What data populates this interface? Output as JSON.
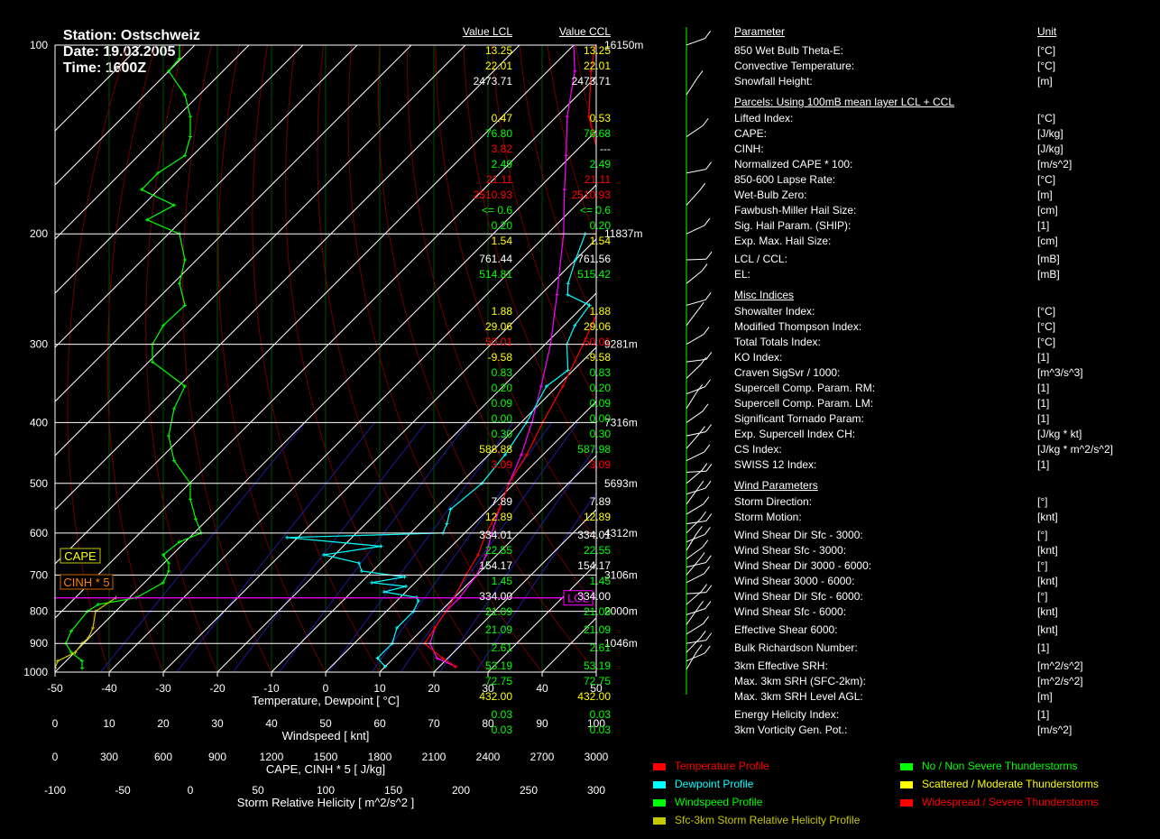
{
  "header": {
    "station": "Station: Ostschweiz",
    "date": "Date: 19.03.2005",
    "time": "Time: 1600Z"
  },
  "colors": {
    "temperature": "#ff0000",
    "dewpoint": "#00ffff",
    "windspeed": "#00ff00",
    "srh": "#c8c800",
    "parcel": "#ff00ff",
    "isotherm": "#005000",
    "isohume": "#1c1c9a",
    "dry_adiabat": "#6a0000"
  },
  "chart_data": {
    "type": "line",
    "title": "",
    "xlabel": "Temperature, Dewpoint [ °C]",
    "ylabel": "",
    "x_axes": [
      {
        "label": "Temperature, Dewpoint [ °C]",
        "ticks": [
          "-50",
          "-40",
          "-30",
          "-20",
          "-10",
          "0",
          "10",
          "20",
          "30",
          "40",
          "50"
        ],
        "range": [
          -50,
          50
        ]
      },
      {
        "label": "Windspeed [ knt]",
        "ticks": [
          "0",
          "10",
          "20",
          "30",
          "40",
          "50",
          "60",
          "70",
          "80",
          "90",
          "100"
        ],
        "range": [
          0,
          100
        ]
      },
      {
        "label": "CAPE, CINH * 5 [ J/kg]",
        "ticks": [
          "0",
          "300",
          "600",
          "900",
          "1200",
          "1500",
          "1800",
          "2100",
          "2400",
          "2700",
          "3000"
        ],
        "range": [
          0,
          3000
        ]
      },
      {
        "label": "Storm Relative Helicity [ m^2/s^2 ]",
        "ticks": [
          "-100",
          "-50",
          "0",
          "50",
          "100",
          "150",
          "200",
          "250",
          "300"
        ],
        "range": [
          -100,
          300
        ]
      }
    ],
    "pressure_levels": [
      {
        "p": 100,
        "label": "100",
        "height": "16150m"
      },
      {
        "p": 200,
        "label": "200",
        "height": "11837m"
      },
      {
        "p": 300,
        "label": "300",
        "height": "9281m"
      },
      {
        "p": 400,
        "label": "400",
        "height": "7316m"
      },
      {
        "p": 500,
        "label": "500",
        "height": "5693m"
      },
      {
        "p": 600,
        "label": "600",
        "height": "4312m"
      },
      {
        "p": 700,
        "label": "700",
        "height": "3106m"
      },
      {
        "p": 800,
        "label": "800",
        "height": "2000m"
      },
      {
        "p": 900,
        "label": "900",
        "height": "1046m"
      },
      {
        "p": 1000,
        "label": "1000",
        "height": ""
      }
    ],
    "annotations": {
      "cape": "CAPE",
      "cinh": "CINH * 5",
      "lcl": "LCL",
      "lcl_p": 761.44
    },
    "series": [
      {
        "name": "Temperature Profile",
        "unit": "°C",
        "points": [
          [
            980,
            23
          ],
          [
            950,
            19
          ],
          [
            900,
            13
          ],
          [
            850,
            12
          ],
          [
            800,
            11
          ],
          [
            761,
            10
          ],
          [
            700,
            8
          ],
          [
            650,
            6.5
          ],
          [
            600,
            4
          ],
          [
            550,
            2
          ],
          [
            500,
            -1
          ],
          [
            450,
            -3
          ],
          [
            400,
            -6
          ],
          [
            350,
            -9
          ],
          [
            300,
            -13
          ],
          [
            250,
            -18
          ],
          [
            220,
            -22
          ],
          [
            200,
            -26
          ],
          [
            190,
            -30
          ],
          [
            170,
            -37
          ],
          [
            150,
            -45
          ],
          [
            130,
            -54
          ],
          [
            110,
            -62
          ],
          [
            100,
            -66
          ]
        ]
      },
      {
        "name": "Dewpoint Profile",
        "unit": "°C",
        "points": [
          [
            980,
            10
          ],
          [
            950,
            7
          ],
          [
            900,
            7
          ],
          [
            850,
            5
          ],
          [
            800,
            5
          ],
          [
            770,
            4
          ],
          [
            760,
            3
          ],
          [
            745,
            -4
          ],
          [
            730,
            -1
          ],
          [
            720,
            -8
          ],
          [
            705,
            -3
          ],
          [
            690,
            -12
          ],
          [
            670,
            -14
          ],
          [
            650,
            -22
          ],
          [
            630,
            -13
          ],
          [
            610,
            -32
          ],
          [
            600,
            -4
          ],
          [
            580,
            -5
          ],
          [
            550,
            -7
          ],
          [
            500,
            -6
          ],
          [
            450,
            -7
          ],
          [
            400,
            -9
          ],
          [
            350,
            -12
          ],
          [
            330,
            -11
          ],
          [
            300,
            -16
          ],
          [
            280,
            -18
          ],
          [
            260,
            -19
          ],
          [
            250,
            -25
          ],
          [
            240,
            -27
          ],
          [
            220,
            -30
          ],
          [
            200,
            -33
          ]
        ]
      },
      {
        "name": "Parcel",
        "unit": "°C",
        "points": [
          [
            980,
            23
          ],
          [
            950,
            18
          ],
          [
            900,
            14
          ],
          [
            850,
            12
          ],
          [
            800,
            11
          ],
          [
            761,
            11
          ],
          [
            700,
            10
          ],
          [
            650,
            8
          ],
          [
            600,
            5
          ],
          [
            550,
            2
          ],
          [
            500,
            -1
          ],
          [
            450,
            -4
          ],
          [
            400,
            -8
          ],
          [
            350,
            -13
          ],
          [
            300,
            -19
          ],
          [
            250,
            -27
          ],
          [
            200,
            -37
          ],
          [
            170,
            -45
          ],
          [
            150,
            -51
          ],
          [
            130,
            -58
          ],
          [
            110,
            -65
          ],
          [
            100,
            -70
          ]
        ]
      },
      {
        "name": "Windspeed Profile",
        "unit": "knt",
        "points": [
          [
            985,
            5
          ],
          [
            960,
            5
          ],
          [
            930,
            3
          ],
          [
            900,
            2
          ],
          [
            860,
            3
          ],
          [
            800,
            6
          ],
          [
            780,
            8
          ],
          [
            761,
            15
          ],
          [
            720,
            20
          ],
          [
            690,
            21
          ],
          [
            670,
            21
          ],
          [
            650,
            20
          ],
          [
            620,
            23
          ],
          [
            600,
            27
          ],
          [
            570,
            26
          ],
          [
            530,
            25
          ],
          [
            500,
            25
          ],
          [
            460,
            22
          ],
          [
            420,
            21
          ],
          [
            380,
            22
          ],
          [
            350,
            24
          ],
          [
            320,
            18
          ],
          [
            300,
            18
          ],
          [
            280,
            20
          ],
          [
            260,
            24
          ],
          [
            240,
            23
          ],
          [
            220,
            24
          ],
          [
            200,
            23
          ],
          [
            190,
            17
          ],
          [
            180,
            22
          ],
          [
            170,
            16
          ],
          [
            160,
            19
          ],
          [
            150,
            24
          ],
          [
            140,
            25
          ],
          [
            130,
            25
          ],
          [
            120,
            24
          ],
          [
            110,
            21
          ],
          [
            105,
            23
          ],
          [
            100,
            23
          ]
        ]
      },
      {
        "name": "Sfc-3km Storm Relative Helicity Profile",
        "unit": "m^2/s^2",
        "points": [
          [
            985,
            -100
          ],
          [
            960,
            -98
          ],
          [
            930,
            -85
          ],
          [
            900,
            -80
          ],
          [
            880,
            -75
          ],
          [
            850,
            -72
          ],
          [
            800,
            -70
          ],
          [
            761,
            -55
          ]
        ]
      }
    ],
    "wind_barbs_note": "Wind barbs shown on right-hand column"
  },
  "legend": [
    {
      "label": "Temperature Profile",
      "color": "#ff0000",
      "text_color": "#ff0000"
    },
    {
      "label": "Dewpoint Profile",
      "color": "#00ffff",
      "text_color": "#00ffff"
    },
    {
      "label": "Windspeed Profile",
      "color": "#00ff00",
      "text_color": "#00ff00"
    },
    {
      "label": "Sfc-3km Storm Relative Helicity Profile",
      "color": "#c8c800",
      "text_color": "#c8c800"
    },
    {
      "label": "No / Non Severe Thunderstorms",
      "color": "#00ff00",
      "text_color": "#00ff00"
    },
    {
      "label": "Scattered / Moderate Thunderstorms",
      "color": "#ffff00",
      "text_color": "#ffff00"
    },
    {
      "label": "Widespread / Severe Thunderstorms",
      "color": "#ff0000",
      "text_color": "#ff0000"
    }
  ],
  "table": {
    "header": {
      "param": "Parameter",
      "lcl": "Value LCL",
      "ccl": "Value CCL",
      "unit": "Unit"
    },
    "rows": [
      {
        "label": "850 Wet Bulb Theta-E:",
        "v1": "13.25",
        "v2": "13.25",
        "unit": "[°C]",
        "c": "yellow"
      },
      {
        "label": "Convective Temperature:",
        "v1": "22.01",
        "v2": "22.01",
        "unit": "[°C]",
        "c": "yellow"
      },
      {
        "label": "Snowfall Height:",
        "v1": "2473.71",
        "v2": "2473.71",
        "unit": "[m]",
        "c": "white"
      },
      {
        "section": "Parcels: Using 100mB mean layer LCL + CCL"
      },
      {
        "label": "Lifted Index:",
        "v1": "0.47",
        "v2": "0.53",
        "unit": "[°C]",
        "c": "yellow"
      },
      {
        "label": "CAPE:",
        "v1": "76.80",
        "v2": "76.68",
        "unit": "[J/kg]",
        "c": "green"
      },
      {
        "label": "CINH:",
        "v1": "3.82",
        "v2": "---",
        "unit": "[J/kg]",
        "c": "red",
        "c2": "white"
      },
      {
        "label": "Normalized CAPE * 100:",
        "v1": "2.49",
        "v2": "2.49",
        "unit": "[m/s^2]",
        "c": "green"
      },
      {
        "label": "850-600 Lapse Rate:",
        "v1": "21.11",
        "v2": "21.11",
        "unit": "[°C]",
        "c": "red"
      },
      {
        "label": "Wet-Bulb Zero:",
        "v1": "2510.93",
        "v2": "2510.93",
        "unit": "[m]",
        "c": "red"
      },
      {
        "label": "Fawbush-Miller Hail Size:",
        "v1": "<= 0.6",
        "v2": "<= 0.6",
        "unit": "[cm]",
        "c": "green"
      },
      {
        "label": "Sig. Hail Param. (SHIP):",
        "v1": "0.20",
        "v2": "0.20",
        "unit": "[1]",
        "c": "green"
      },
      {
        "label": "Exp. Max. Hail Size:",
        "v1": "1.54",
        "v2": "1.54",
        "unit": "[cm]",
        "c": "yellow"
      },
      {
        "label": "LCL / CCL:",
        "v1": "761.44",
        "v2": "761.56",
        "unit": "[mB]",
        "c": "white",
        "gap": 3
      },
      {
        "label": "EL:",
        "v1": "514.81",
        "v2": "515.42",
        "unit": "[mB]",
        "c": "green"
      },
      {
        "section": "Misc Indices"
      },
      {
        "label": "Showalter Index:",
        "v1": "1.88",
        "v2": "1.88",
        "unit": "[°C]",
        "c": "yellow"
      },
      {
        "label": "Modified Thompson Index:",
        "v1": "29.06",
        "v2": "29.06",
        "unit": "[°C]",
        "c": "yellow"
      },
      {
        "label": "Total Totals Index:",
        "v1": "50.01",
        "v2": "50.01",
        "unit": "[°C]",
        "c": "red"
      },
      {
        "label": "KO Index:",
        "v1": "-9.58",
        "v2": "-9.58",
        "unit": "[1]",
        "c": "yellow"
      },
      {
        "label": "Craven SigSvr / 1000:",
        "v1": "0.83",
        "v2": "0.83",
        "unit": "[m^3/s^3]",
        "c": "green"
      },
      {
        "label": "Supercell Comp. Param. RM:",
        "v1": "0.20",
        "v2": "0.20",
        "unit": "[1]",
        "c": "green"
      },
      {
        "label": "Supercell Comp. Param. LM:",
        "v1": "0.09",
        "v2": "0.09",
        "unit": "[1]",
        "c": "green"
      },
      {
        "label": "Significant Tornado Param:",
        "v1": "0.00",
        "v2": "0.00",
        "unit": "[1]",
        "c": "green"
      },
      {
        "label": "Exp. Supercell Index CH:",
        "v1": "0.30",
        "v2": "0.30",
        "unit": "[J/kg * kt]",
        "c": "green"
      },
      {
        "label": "CS Index:",
        "v1": "588.88",
        "v2": "587.98",
        "unit": "[J/kg * m^2/s^2]",
        "c": "yellow",
        "c2": "green"
      },
      {
        "label": "SWISS 12 Index:",
        "v1": "3.09",
        "v2": "3.09",
        "unit": "[1]",
        "c": "red"
      },
      {
        "section": "Wind Parameters"
      },
      {
        "label": "Storm Direction:",
        "v1": "7.89",
        "v2": "7.89",
        "unit": "[°]",
        "c": "white"
      },
      {
        "label": "Storm Motion:",
        "v1": "12.89",
        "v2": "12.89",
        "unit": "[knt]",
        "c": "yellow"
      },
      {
        "label": "Wind Shear Dir Sfc - 3000:",
        "v1": "334.01",
        "v2": "334.01",
        "unit": "[°]",
        "c": "white",
        "gap": 3
      },
      {
        "label": "Wind Shear Sfc - 3000:",
        "v1": "22.55",
        "v2": "22.55",
        "unit": "[knt]",
        "c": "green"
      },
      {
        "label": "Wind Shear Dir 3000 - 6000:",
        "v1": "154.17",
        "v2": "154.17",
        "unit": "[°]",
        "c": "white"
      },
      {
        "label": "Wind Shear 3000 - 6000:",
        "v1": "1.45",
        "v2": "1.45",
        "unit": "[knt]",
        "c": "green"
      },
      {
        "label": "Wind Shear Dir Sfc - 6000:",
        "v1": "334.00",
        "v2": "334.00",
        "unit": "[°]",
        "c": "white"
      },
      {
        "label": "Wind Shear Sfc - 6000:",
        "v1": "21.09",
        "v2": "21.09",
        "unit": "[knt]",
        "c": "green"
      },
      {
        "label": "Effective Shear 6000:",
        "v1": "21.09",
        "v2": "21.09",
        "unit": "[knt]",
        "c": "green",
        "gap": 3
      },
      {
        "label": "Bulk Richardson Number:",
        "v1": "2.61",
        "v2": "2.61",
        "unit": "[1]",
        "c": "green",
        "gap": 3
      },
      {
        "label": "3km Effective SRH:",
        "v1": "53.19",
        "v2": "53.19",
        "unit": "[m^2/s^2]",
        "c": "green",
        "gap": 3
      },
      {
        "label": "Max. 3km SRH (SFC-2km):",
        "v1": "72.75",
        "v2": "72.75",
        "unit": "[m^2/s^2]",
        "c": "green"
      },
      {
        "label": "Max. 3km SRH Level AGL:",
        "v1": "432.00",
        "v2": "432.00",
        "unit": "[m]",
        "c": "yellow"
      },
      {
        "label": "Energy Helicity Index:",
        "v1": "0.03",
        "v2": "0.03",
        "unit": "[1]",
        "c": "green",
        "gap": 3
      },
      {
        "label": "3km Vorticity Gen. Pot.:",
        "v1": "0.03",
        "v2": "0.03",
        "unit": "[m/s^2]",
        "c": "green"
      }
    ]
  }
}
